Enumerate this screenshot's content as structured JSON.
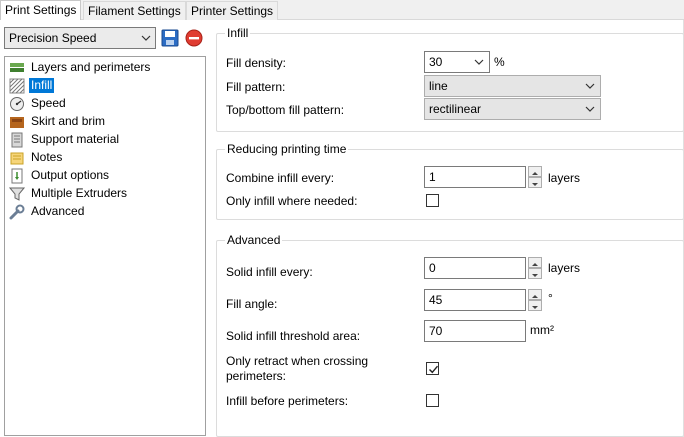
{
  "tabs": [
    {
      "label": "Print Settings",
      "active": true
    },
    {
      "label": "Filament Settings",
      "active": false
    },
    {
      "label": "Printer Settings",
      "active": false
    }
  ],
  "preset": {
    "value": "Precision Speed"
  },
  "tree": {
    "items": [
      {
        "label": "Layers and perimeters",
        "icon": "layers-icon"
      },
      {
        "label": "Infill",
        "icon": "infill-icon",
        "selected": true
      },
      {
        "label": "Speed",
        "icon": "speed-gauge-icon"
      },
      {
        "label": "Skirt and brim",
        "icon": "skirt-brim-icon"
      },
      {
        "label": "Support material",
        "icon": "support-material-icon"
      },
      {
        "label": "Notes",
        "icon": "notes-icon"
      },
      {
        "label": "Output options",
        "icon": "output-options-icon"
      },
      {
        "label": "Multiple Extruders",
        "icon": "funnel-icon"
      },
      {
        "label": "Advanced",
        "icon": "wrench-icon"
      }
    ]
  },
  "infill": {
    "title": "Infill",
    "density_label": "Fill density:",
    "density_value": "30",
    "density_unit": "%",
    "pattern_label": "Fill pattern:",
    "pattern_value": "line",
    "topbottom_label": "Top/bottom fill pattern:",
    "topbottom_value": "rectilinear"
  },
  "reducing": {
    "title": "Reducing printing time",
    "combine_label": "Combine infill every:",
    "combine_value": "1",
    "combine_unit": "layers",
    "only_needed_label": "Only infill where needed:",
    "only_needed_checked": false
  },
  "advanced": {
    "title": "Advanced",
    "solid_every_label": "Solid infill every:",
    "solid_every_value": "0",
    "solid_every_unit": "layers",
    "angle_label": "Fill angle:",
    "angle_value": "45",
    "angle_unit": "°",
    "threshold_label": "Solid infill threshold area:",
    "threshold_value": "70",
    "threshold_unit": "mm²",
    "retract_label_1": "Only retract when crossing",
    "retract_label_2": "perimeters:",
    "retract_checked": true,
    "before_perimeters_label": "Infill before perimeters:",
    "before_perimeters_checked": false
  },
  "colors": {
    "selection": "#0078d7",
    "save_icon": "#2b6cc4",
    "delete_icon": "#e03c31"
  }
}
